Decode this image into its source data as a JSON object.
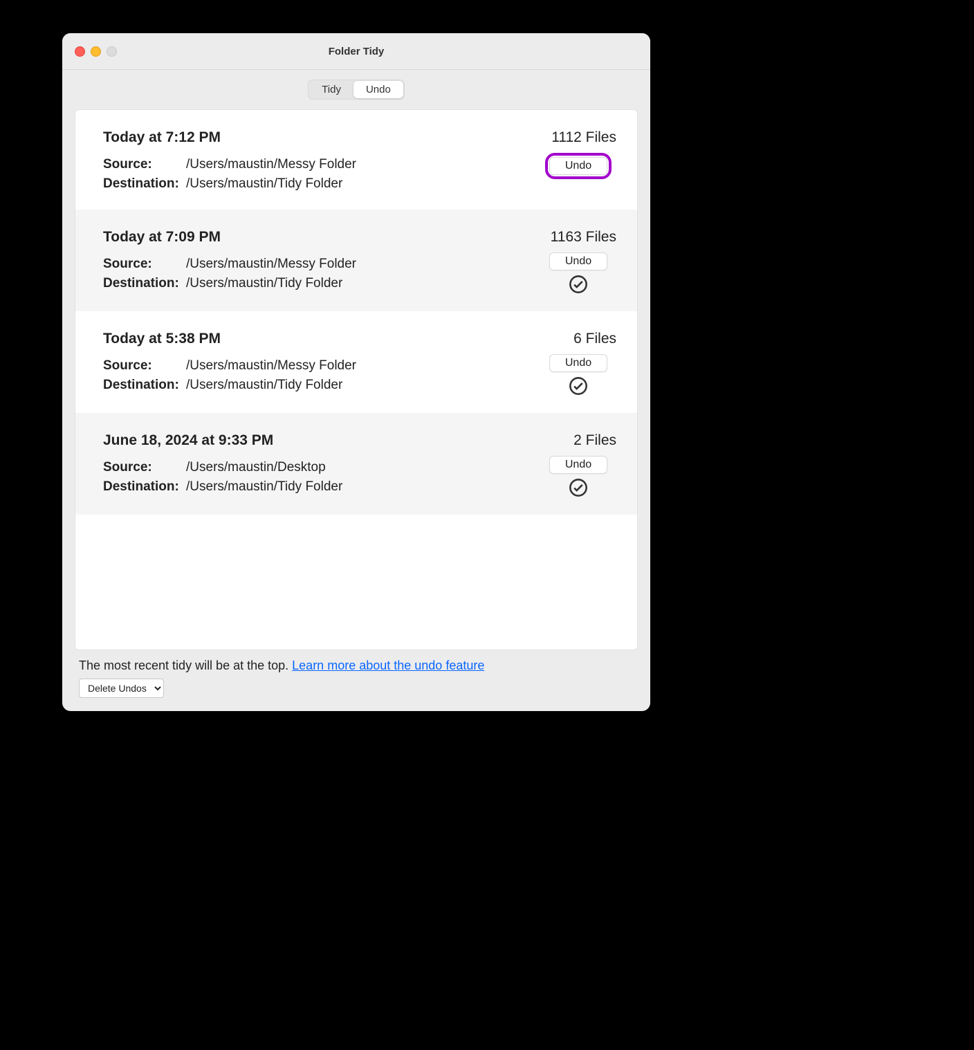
{
  "window": {
    "title": "Folder Tidy"
  },
  "tabs": {
    "tidy": "Tidy",
    "undo": "Undo"
  },
  "labels": {
    "source": "Source:",
    "destination": "Destination:"
  },
  "entries": [
    {
      "time": "Today at 7:12 PM",
      "files": "1112 Files",
      "source": "/Users/maustin/Messy Folder",
      "destination": "/Users/maustin/Tidy Folder",
      "undo": "Undo",
      "highlight": true,
      "check": false,
      "alt": false
    },
    {
      "time": "Today at 7:09 PM",
      "files": "1163 Files",
      "source": "/Users/maustin/Messy Folder",
      "destination": "/Users/maustin/Tidy Folder",
      "undo": "Undo",
      "highlight": false,
      "check": true,
      "alt": true
    },
    {
      "time": "Today at 5:38 PM",
      "files": "6 Files",
      "source": "/Users/maustin/Messy Folder",
      "destination": "/Users/maustin/Tidy Folder",
      "undo": "Undo",
      "highlight": false,
      "check": true,
      "alt": false
    },
    {
      "time": "June 18, 2024 at 9:33 PM",
      "files": "2 Files",
      "source": "/Users/maustin/Desktop",
      "destination": "/Users/maustin/Tidy Folder",
      "undo": "Undo",
      "highlight": false,
      "check": true,
      "alt": true
    }
  ],
  "footer": {
    "text": "The most recent tidy will be at the top.  ",
    "link": "Learn more about the undo feature"
  },
  "deleteUndos": "Delete Undos"
}
